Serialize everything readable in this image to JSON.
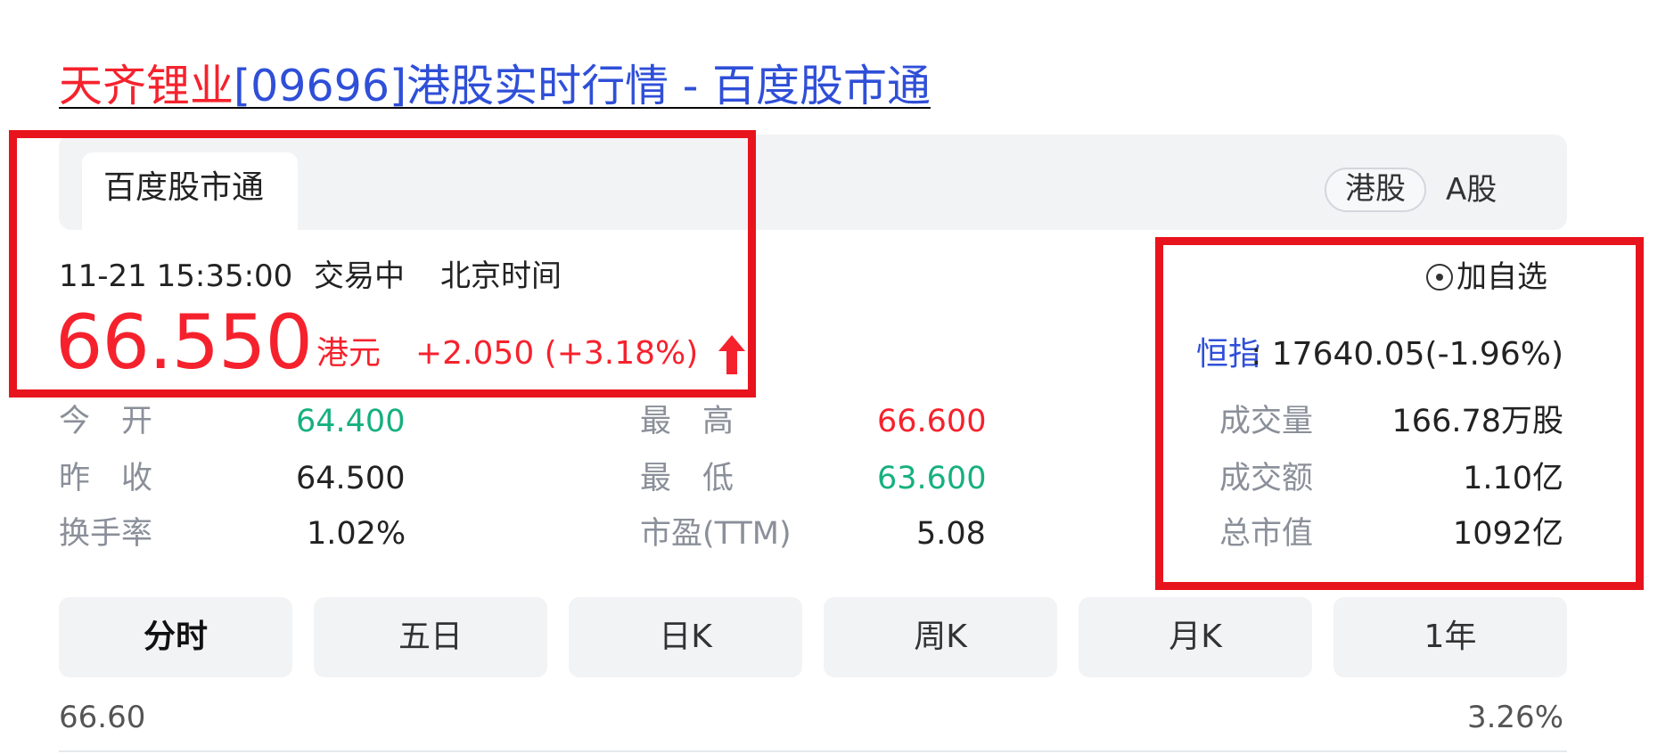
{
  "title": {
    "highlight": "天齐锂业",
    "rest": "[09696]港股实时行情 - 百度股市通"
  },
  "header": {
    "tab_label": "百度股市通",
    "markets": [
      "港股",
      "A股"
    ]
  },
  "quote": {
    "time": "11-21 15:35:00",
    "status": "交易中",
    "timezone": "北京时间",
    "price": "66.550",
    "currency": "港元",
    "change": "+2.050 (+3.18%)",
    "direction": "up"
  },
  "stats": [
    {
      "label": "今　开",
      "value": "64.400",
      "color": "green"
    },
    {
      "label": "最　高",
      "value": "66.600",
      "color": "red"
    },
    {
      "label": "昨　收",
      "value": "64.500",
      "color": "neutral"
    },
    {
      "label": "最　低",
      "value": "63.600",
      "color": "green"
    },
    {
      "label": "换手率",
      "value": "1.02%",
      "color": "neutral"
    },
    {
      "label": "市盈(TTM)",
      "value": "5.08",
      "color": "neutral"
    }
  ],
  "side": {
    "watch_label": "加自选",
    "index_label": "恒指",
    "index_value": ": 17640.05(-1.96%)",
    "items": [
      {
        "label": "成交量",
        "value": "166.78万股"
      },
      {
        "label": "成交额",
        "value": "1.10亿"
      },
      {
        "label": "总市值",
        "value": "1092亿"
      }
    ]
  },
  "periods": [
    "分时",
    "五日",
    "日K",
    "周K",
    "月K",
    "1年"
  ],
  "chart": {
    "top_price": "66.60",
    "top_pct": "3.26%"
  },
  "colors": {
    "up": "#f5222d",
    "down": "#16b07f",
    "link": "#2f4fd8",
    "annotation": "#e8141d"
  }
}
